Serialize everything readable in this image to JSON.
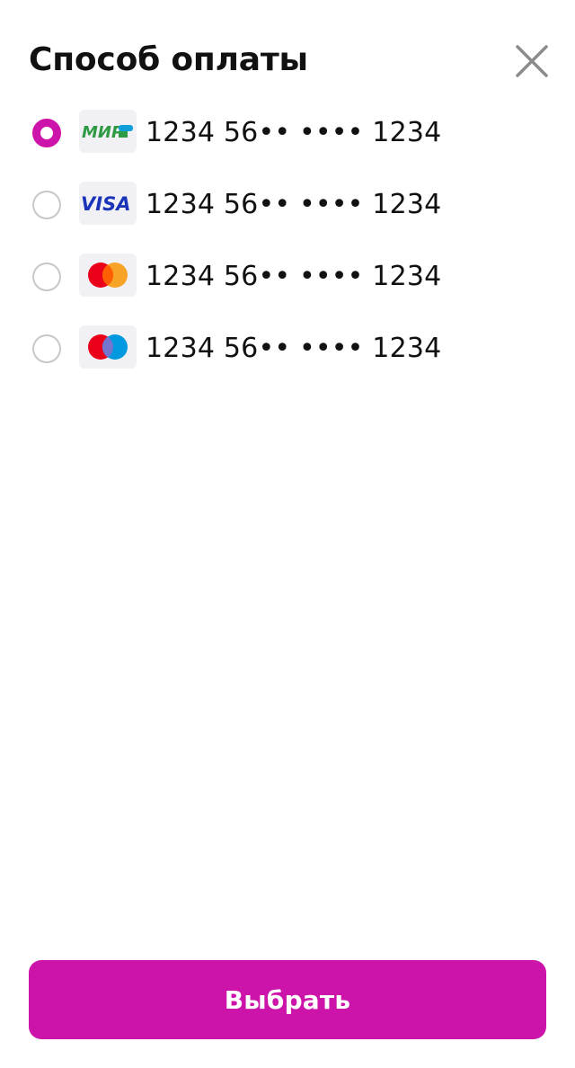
{
  "header": {
    "title": "Способ оплаты",
    "close_icon": "close-icon"
  },
  "payment_methods": [
    {
      "brand": "mir",
      "logo_text": "МИР",
      "number": "1234 56•• •••• 1234",
      "selected": true
    },
    {
      "brand": "visa",
      "logo_text": "VISA",
      "number": "1234 56•• •••• 1234",
      "selected": false
    },
    {
      "brand": "mastercard",
      "number": "1234 56•• •••• 1234",
      "selected": false
    },
    {
      "brand": "maestro",
      "number": "1234 56•• •••• 1234",
      "selected": false
    }
  ],
  "footer": {
    "select_label": "Выбрать"
  },
  "colors": {
    "accent": "#cc14aa",
    "radio_border": "#c8c8c8",
    "logo_bg": "#f1f1f5",
    "close_icon": "#8c8c8c",
    "mir_green": "#2f9a44",
    "visa_blue": "#1a33b8",
    "mc_red": "#eb001b",
    "mc_orange": "#f79e1b",
    "maestro_blue": "#0099df"
  }
}
